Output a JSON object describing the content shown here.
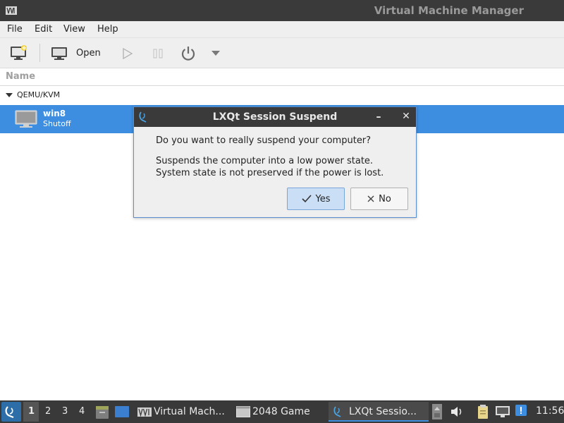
{
  "window": {
    "title": "Virtual Machine Manager"
  },
  "menu": [
    "File",
    "Edit",
    "View",
    "Help"
  ],
  "toolbar": {
    "open_label": "Open"
  },
  "list": {
    "column_header": "Name",
    "group": "QEMU/KVM",
    "vms": [
      {
        "name": "win8",
        "state": "Shutoff"
      }
    ]
  },
  "dialog": {
    "title": "LXQt Session Suspend",
    "minimize_glyph": "–",
    "close_glyph": "✕",
    "question": "Do you want to really suspend your computer?",
    "description_line1": "Suspends the computer into a low power state.",
    "description_line2": "System state is not preserved if the power is lost.",
    "yes_label": "Yes",
    "no_label": "No"
  },
  "taskbar": {
    "desktops": [
      "1",
      "2",
      "3",
      "4"
    ],
    "active_desktop": "1",
    "tasks": [
      {
        "label": "Virtual Mach..."
      },
      {
        "label": "2048 Game"
      },
      {
        "label": "LXQt Sessio..."
      }
    ],
    "clock": "11:56"
  },
  "colors": {
    "selection": "#3d8ee0",
    "titlebar": "#3a3a3a",
    "panel": "#393939",
    "accent_border": "#5c8fd0"
  }
}
